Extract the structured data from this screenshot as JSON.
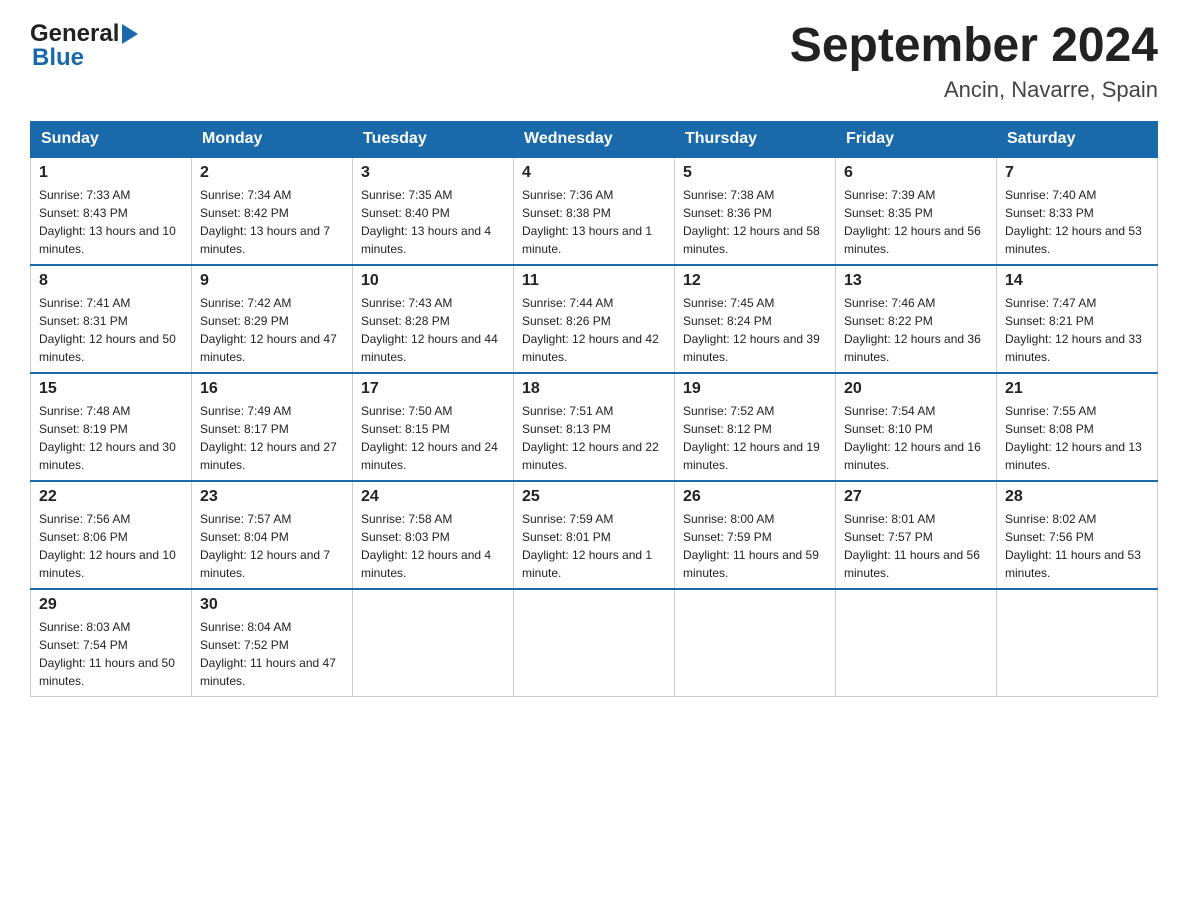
{
  "header": {
    "logo_general": "General",
    "logo_blue": "Blue",
    "month_title": "September 2024",
    "location": "Ancin, Navarre, Spain"
  },
  "weekdays": [
    "Sunday",
    "Monday",
    "Tuesday",
    "Wednesday",
    "Thursday",
    "Friday",
    "Saturday"
  ],
  "weeks": [
    [
      {
        "day": "1",
        "sunrise": "7:33 AM",
        "sunset": "8:43 PM",
        "daylight": "13 hours and 10 minutes."
      },
      {
        "day": "2",
        "sunrise": "7:34 AM",
        "sunset": "8:42 PM",
        "daylight": "13 hours and 7 minutes."
      },
      {
        "day": "3",
        "sunrise": "7:35 AM",
        "sunset": "8:40 PM",
        "daylight": "13 hours and 4 minutes."
      },
      {
        "day": "4",
        "sunrise": "7:36 AM",
        "sunset": "8:38 PM",
        "daylight": "13 hours and 1 minute."
      },
      {
        "day": "5",
        "sunrise": "7:38 AM",
        "sunset": "8:36 PM",
        "daylight": "12 hours and 58 minutes."
      },
      {
        "day": "6",
        "sunrise": "7:39 AM",
        "sunset": "8:35 PM",
        "daylight": "12 hours and 56 minutes."
      },
      {
        "day": "7",
        "sunrise": "7:40 AM",
        "sunset": "8:33 PM",
        "daylight": "12 hours and 53 minutes."
      }
    ],
    [
      {
        "day": "8",
        "sunrise": "7:41 AM",
        "sunset": "8:31 PM",
        "daylight": "12 hours and 50 minutes."
      },
      {
        "day": "9",
        "sunrise": "7:42 AM",
        "sunset": "8:29 PM",
        "daylight": "12 hours and 47 minutes."
      },
      {
        "day": "10",
        "sunrise": "7:43 AM",
        "sunset": "8:28 PM",
        "daylight": "12 hours and 44 minutes."
      },
      {
        "day": "11",
        "sunrise": "7:44 AM",
        "sunset": "8:26 PM",
        "daylight": "12 hours and 42 minutes."
      },
      {
        "day": "12",
        "sunrise": "7:45 AM",
        "sunset": "8:24 PM",
        "daylight": "12 hours and 39 minutes."
      },
      {
        "day": "13",
        "sunrise": "7:46 AM",
        "sunset": "8:22 PM",
        "daylight": "12 hours and 36 minutes."
      },
      {
        "day": "14",
        "sunrise": "7:47 AM",
        "sunset": "8:21 PM",
        "daylight": "12 hours and 33 minutes."
      }
    ],
    [
      {
        "day": "15",
        "sunrise": "7:48 AM",
        "sunset": "8:19 PM",
        "daylight": "12 hours and 30 minutes."
      },
      {
        "day": "16",
        "sunrise": "7:49 AM",
        "sunset": "8:17 PM",
        "daylight": "12 hours and 27 minutes."
      },
      {
        "day": "17",
        "sunrise": "7:50 AM",
        "sunset": "8:15 PM",
        "daylight": "12 hours and 24 minutes."
      },
      {
        "day": "18",
        "sunrise": "7:51 AM",
        "sunset": "8:13 PM",
        "daylight": "12 hours and 22 minutes."
      },
      {
        "day": "19",
        "sunrise": "7:52 AM",
        "sunset": "8:12 PM",
        "daylight": "12 hours and 19 minutes."
      },
      {
        "day": "20",
        "sunrise": "7:54 AM",
        "sunset": "8:10 PM",
        "daylight": "12 hours and 16 minutes."
      },
      {
        "day": "21",
        "sunrise": "7:55 AM",
        "sunset": "8:08 PM",
        "daylight": "12 hours and 13 minutes."
      }
    ],
    [
      {
        "day": "22",
        "sunrise": "7:56 AM",
        "sunset": "8:06 PM",
        "daylight": "12 hours and 10 minutes."
      },
      {
        "day": "23",
        "sunrise": "7:57 AM",
        "sunset": "8:04 PM",
        "daylight": "12 hours and 7 minutes."
      },
      {
        "day": "24",
        "sunrise": "7:58 AM",
        "sunset": "8:03 PM",
        "daylight": "12 hours and 4 minutes."
      },
      {
        "day": "25",
        "sunrise": "7:59 AM",
        "sunset": "8:01 PM",
        "daylight": "12 hours and 1 minute."
      },
      {
        "day": "26",
        "sunrise": "8:00 AM",
        "sunset": "7:59 PM",
        "daylight": "11 hours and 59 minutes."
      },
      {
        "day": "27",
        "sunrise": "8:01 AM",
        "sunset": "7:57 PM",
        "daylight": "11 hours and 56 minutes."
      },
      {
        "day": "28",
        "sunrise": "8:02 AM",
        "sunset": "7:56 PM",
        "daylight": "11 hours and 53 minutes."
      }
    ],
    [
      {
        "day": "29",
        "sunrise": "8:03 AM",
        "sunset": "7:54 PM",
        "daylight": "11 hours and 50 minutes."
      },
      {
        "day": "30",
        "sunrise": "8:04 AM",
        "sunset": "7:52 PM",
        "daylight": "11 hours and 47 minutes."
      },
      null,
      null,
      null,
      null,
      null
    ]
  ],
  "labels": {
    "sunrise": "Sunrise:",
    "sunset": "Sunset:",
    "daylight": "Daylight:"
  }
}
